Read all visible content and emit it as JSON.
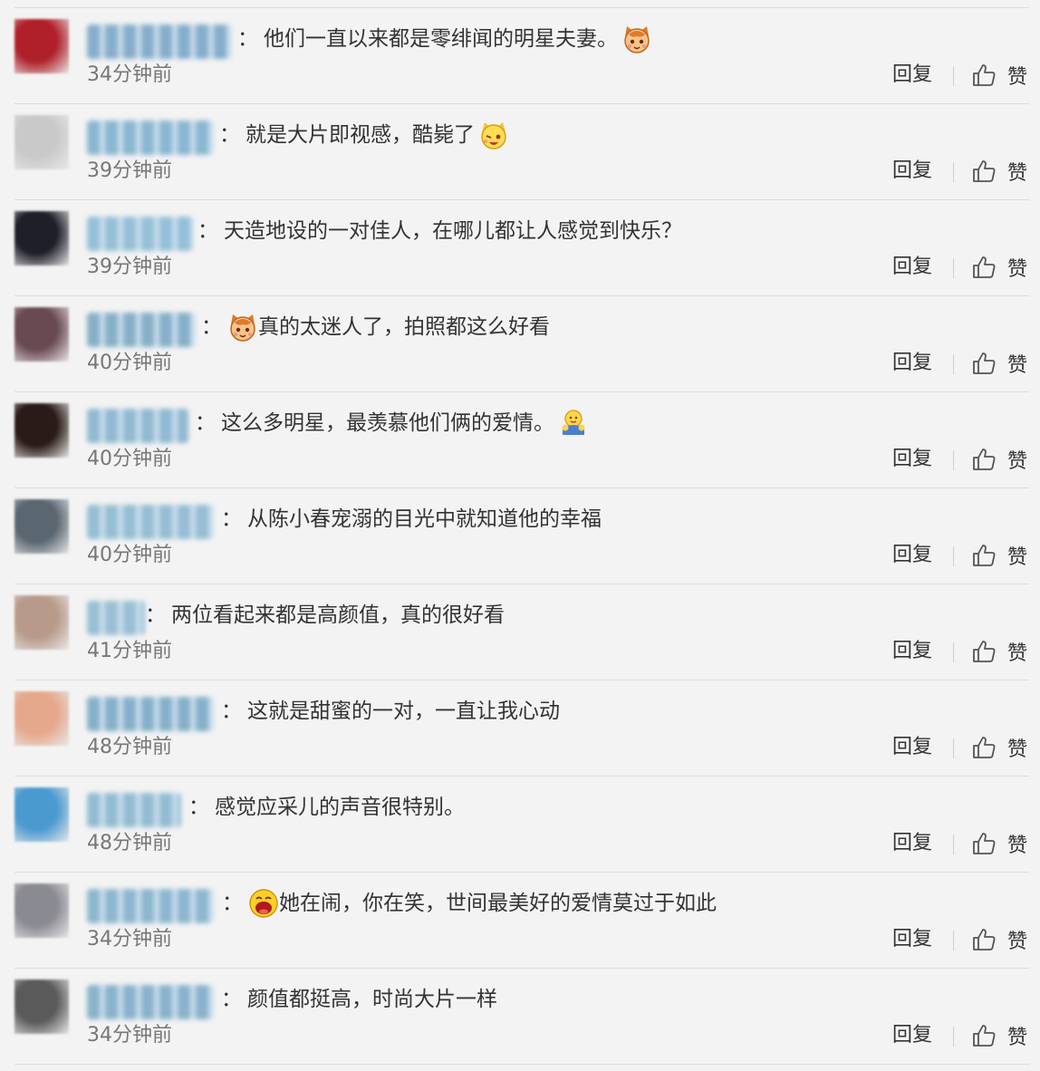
{
  "comments": [
    {
      "text": "他们一直以来都是零绯闻的明星夫妻。",
      "emoji": "cat-emoji",
      "emoji_pos": "after",
      "time": "34分钟前",
      "reply": "回复",
      "like": "赞",
      "user_color": "#7aa6c8",
      "avatar_color": "#b0202a"
    },
    {
      "text": "就是大片即视感，酷毙了",
      "emoji": "cat-wink-emoji",
      "emoji_pos": "after",
      "time": "39分钟前",
      "reply": "回复",
      "like": "赞",
      "user_color": "#7fb0ce",
      "avatar_color": "#c9c9c9"
    },
    {
      "text": "天造地设的一对佳人，在哪儿都让人感觉到快乐？",
      "emoji": "",
      "emoji_pos": "",
      "time": "39分钟前",
      "reply": "回复",
      "like": "赞",
      "user_color": "#8bbad6",
      "avatar_color": "#1f1f2a"
    },
    {
      "text": "真的太迷人了，拍照都这么好看",
      "emoji": "cat-emoji",
      "emoji_pos": "before",
      "time": "40分钟前",
      "reply": "回复",
      "like": "赞",
      "user_color": "#7ba8c4",
      "avatar_color": "#6a4a52"
    },
    {
      "text": "这么多明星，最羡慕他们俩的爱情。",
      "emoji": "hug-emoji",
      "emoji_pos": "after",
      "time": "40分钟前",
      "reply": "回复",
      "like": "赞",
      "user_color": "#86b3cf",
      "avatar_color": "#2a1a18"
    },
    {
      "text": "从陈小春宠溺的目光中就知道他的幸福",
      "emoji": "",
      "emoji_pos": "",
      "time": "40分钟前",
      "reply": "回复",
      "like": "赞",
      "user_color": "#8cb8d2",
      "avatar_color": "#5a6670"
    },
    {
      "text": "两位看起来都是高颜值，真的很好看",
      "emoji": "",
      "emoji_pos": "",
      "time": "41分钟前",
      "reply": "回复",
      "like": "赞",
      "user_color": "#8fbad4",
      "avatar_color": "#b89a8a"
    },
    {
      "text": "这就是甜蜜的一对，一直让我心动",
      "emoji": "",
      "emoji_pos": "",
      "time": "48分钟前",
      "reply": "回复",
      "like": "赞",
      "user_color": "#7aa9c6",
      "avatar_color": "#e6a88c"
    },
    {
      "text": "感觉应采儿的声音很特别。",
      "emoji": "",
      "emoji_pos": "",
      "time": "48分钟前",
      "reply": "回复",
      "like": "赞",
      "user_color": "#88b6d0",
      "avatar_color": "#4a9ad0"
    },
    {
      "text": "她在闹，你在笑，世间最美好的爱情莫过于如此",
      "emoji": "laugh-emoji",
      "emoji_pos": "before",
      "time": "34分钟前",
      "reply": "回复",
      "like": "赞",
      "user_color": "#82b0cc",
      "avatar_color": "#8a8a92"
    },
    {
      "text": "颜值都挺高，时尚大片一样",
      "emoji": "",
      "emoji_pos": "",
      "time": "34分钟前",
      "reply": "回复",
      "like": "赞",
      "user_color": "#7eabc8",
      "avatar_color": "#5a5a5a"
    }
  ]
}
